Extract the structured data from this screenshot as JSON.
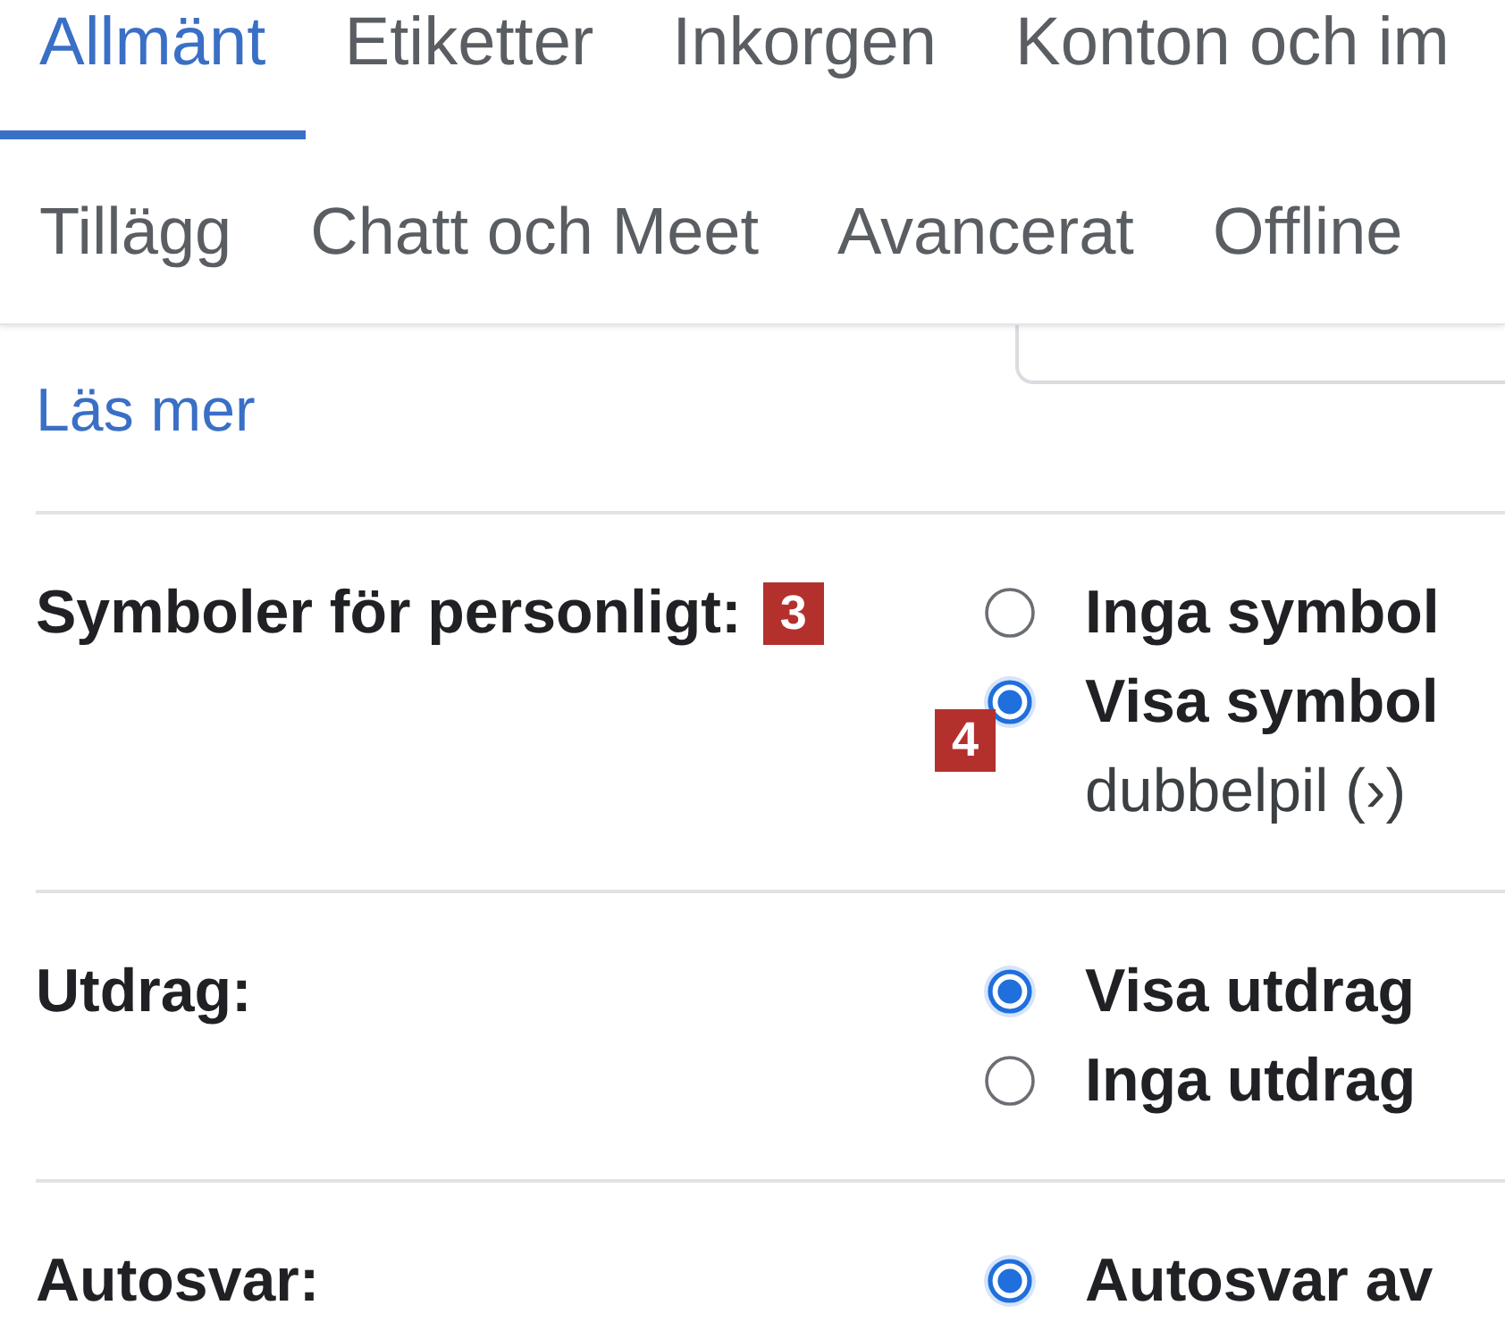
{
  "tabs_primary": [
    {
      "label": "Allmänt",
      "selected": true
    },
    {
      "label": "Etiketter",
      "selected": false
    },
    {
      "label": "Inkorgen",
      "selected": false
    },
    {
      "label": "Konton och im",
      "selected": false
    }
  ],
  "tabs_secondary": [
    {
      "label": "Tillägg",
      "selected": false
    },
    {
      "label": "Chatt och Meet",
      "selected": false
    },
    {
      "label": "Avancerat",
      "selected": false
    },
    {
      "label": "Offline",
      "selected": false
    }
  ],
  "learn_more_link": "Läs mer",
  "settings": [
    {
      "label": "Symboler för personligt:",
      "annotation": "3",
      "options": [
        {
          "label": "Inga symbol",
          "selected": false
        },
        {
          "label": "Visa symbol",
          "selected": true,
          "annotation": "4",
          "description": "dubbelpil (›)"
        }
      ]
    },
    {
      "label": "Utdrag:",
      "options": [
        {
          "label": "Visa utdrag",
          "selected": true
        },
        {
          "label": "Inga utdrag",
          "selected": false
        }
      ]
    },
    {
      "label": "Autosvar:",
      "options": [
        {
          "label": "Autosvar av",
          "selected": true
        }
      ]
    }
  ]
}
